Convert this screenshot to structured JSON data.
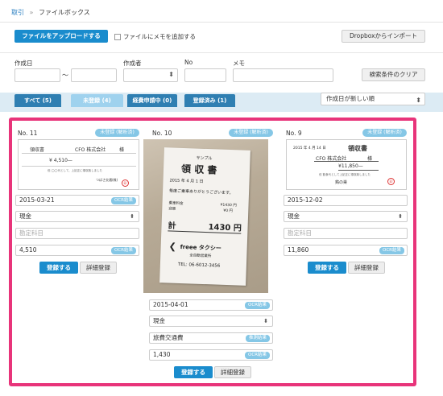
{
  "breadcrumb": {
    "root": "取引",
    "sep": "»",
    "current": "ファイルボックス"
  },
  "toolbar": {
    "upload_label": "ファイルをアップロードする",
    "memo_label": "ファイルにメモを追加する",
    "dropbox_label": "Dropboxからインポート"
  },
  "filters": {
    "date_label": "作成日",
    "date_sep": "〜",
    "creator_label": "作成者",
    "no_label": "No",
    "memo_label": "メモ",
    "clear_label": "検索条件のクリア"
  },
  "tabs": [
    {
      "label": "すべて (5)"
    },
    {
      "label": "未登録 (4)"
    },
    {
      "label": "経費申請中 (0)"
    },
    {
      "label": "登録済み (1)"
    }
  ],
  "sort": {
    "value": "作成日が新しい順"
  },
  "cards": [
    {
      "no": "No. 11",
      "badge": "未登録 (解析済)",
      "receipt": {
        "title": "領収書",
        "company": "CFO 株式会社",
        "honorific": "様",
        "amount": "¥ 4,510—",
        "note": "但 ◯◯代として、上記正に領収致しました",
        "issuer": "つばさ交通(株)",
        "stamp": "印"
      },
      "date": "2015-03-21",
      "date_tag": "OCR結果",
      "payment": "現金",
      "account_placeholder": "勘定科目",
      "amount": "4,510",
      "amount_tag": "OCR結果",
      "register_label": "登録する",
      "detail_label": "詳細登録"
    },
    {
      "no": "No. 10",
      "badge": "未登録 (解析済)",
      "receipt": {
        "sample": "サンプル",
        "title": "領 収 書",
        "date": "2015 年 4 月 1 日",
        "thanks": "毎度ご乗車ありがとうございます。",
        "fare_label": "乗車料金",
        "fare": "¥1430 円",
        "toll_label": "迎車",
        "toll": "¥0 円",
        "total_label": "計",
        "total": "1430 円",
        "brand": "freee タクシー",
        "area": "全自動営業所",
        "tel": "TEL: 06-6012-3456"
      },
      "date": "2015-04-01",
      "date_tag": "OCR結果",
      "payment": "現金",
      "account": "旅費交通費",
      "account_tag": "推測結果",
      "amount": "1,430",
      "amount_tag": "OCR結果",
      "register_label": "登録する",
      "detail_label": "詳細登録"
    },
    {
      "no": "No. 9",
      "badge": "未登録 (解析済)",
      "receipt": {
        "date": "2015 年 4 月 14 日",
        "title": "領収書",
        "company": "CFO 株式会社",
        "honorific": "様",
        "amount": "¥11,850—",
        "note": "但 飲食代として上記正に領収致しました",
        "issuer": "鶏の巣",
        "stamp": "印"
      },
      "date": "2015-12-02",
      "payment": "現金",
      "account_placeholder": "勘定科目",
      "amount": "11,860",
      "amount_tag": "OCR結果",
      "register_label": "登録する",
      "detail_label": "詳細登録"
    }
  ],
  "colors": {
    "primary": "#1a8ccd",
    "badge": "#85c7e6",
    "highlight": "#e8347a",
    "tab_bar": "#dcebf4"
  }
}
